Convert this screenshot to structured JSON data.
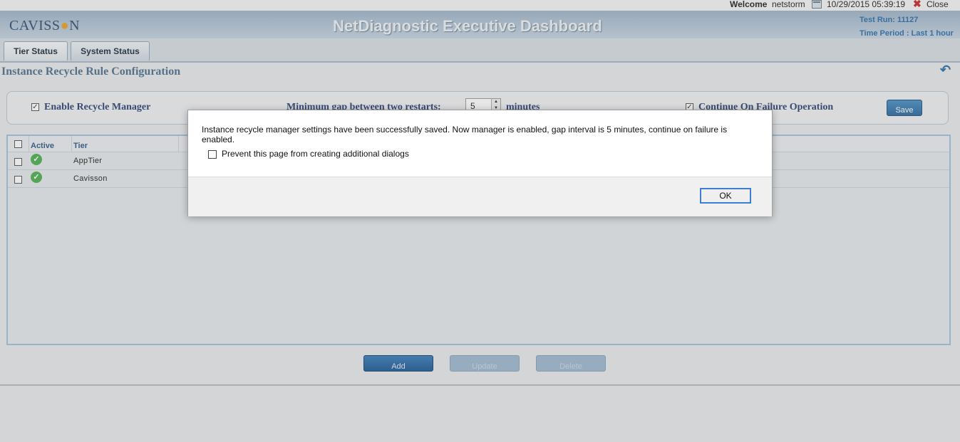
{
  "topbar": {
    "welcome": "Welcome",
    "user": "netstorm",
    "datetime": "10/29/2015 05:39:19",
    "close_label": "Close",
    "calendar_icon": "calendar-icon",
    "close_icon": "close-x-icon"
  },
  "header": {
    "logo_pre": "CAVISS",
    "logo_dot": "●",
    "logo_post": "N",
    "title": "NetDiagnostic Executive Dashboard",
    "test_run": "Test Run: 11127",
    "time_period": "Time Period : Last 1 hour"
  },
  "tabs": [
    {
      "label": "Tier Status"
    },
    {
      "label": "System Status"
    }
  ],
  "page": {
    "title": "Instance Recycle Rule Configuration",
    "undo_icon": "↶"
  },
  "config": {
    "enable_label": "Enable Recycle Manager",
    "enable_checked": true,
    "gap_label": "Minimum gap between two restarts:",
    "gap_value": "5",
    "gap_unit": "minutes",
    "continue_label": "Continue On Failure Operation",
    "continue_checked": true,
    "save_label": "Save"
  },
  "grid": {
    "headers": {
      "active": "Active",
      "tier": "Tier"
    },
    "rows": [
      {
        "active": true,
        "tier": "AppTier"
      },
      {
        "active": true,
        "tier": "Cavisson"
      }
    ]
  },
  "actions": {
    "add": "Add",
    "update": "Update",
    "delete": "Delete"
  },
  "dialog": {
    "message": "Instance recycle manager settings have been successfully saved. Now  manager is enabled, gap interval is 5 minutes, continue on failure is enabled.",
    "prevent_label": "Prevent this page from creating additional dialogs",
    "ok_label": "OK"
  },
  "colors": {
    "accent": "#2d6ea8",
    "header_bg": "#9db3c8",
    "success": "#4caf50"
  }
}
